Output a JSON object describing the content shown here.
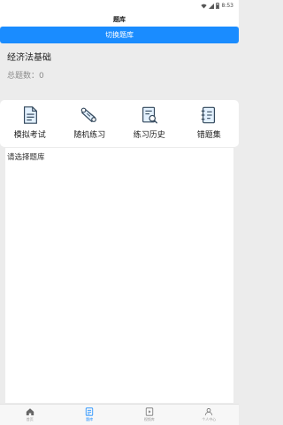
{
  "status_bar": {
    "time": "8:53"
  },
  "header": {
    "title": "题库"
  },
  "switch_button": {
    "label": "切换题库"
  },
  "bank": {
    "name": "经济法基础",
    "count_label": "总题数：0"
  },
  "tools": [
    {
      "label": "模拟考试",
      "icon": "exam-document-icon"
    },
    {
      "label": "随机练习",
      "icon": "scroll-icon"
    },
    {
      "label": "练习历史",
      "icon": "history-search-icon"
    },
    {
      "label": "错题集",
      "icon": "notebook-icon"
    }
  ],
  "content": {
    "placeholder": "请选择题库"
  },
  "tab_bar": {
    "items": [
      {
        "label": "首页",
        "icon": "home-icon"
      },
      {
        "label": "题库",
        "icon": "question-bank-icon",
        "active": true
      },
      {
        "label": "视频库",
        "icon": "video-icon"
      },
      {
        "label": "个人中心",
        "icon": "profile-icon"
      }
    ]
  },
  "colors": {
    "accent": "#1a8cff",
    "icon_dark": "#33485c",
    "icon_light": "#e3f1ff"
  }
}
